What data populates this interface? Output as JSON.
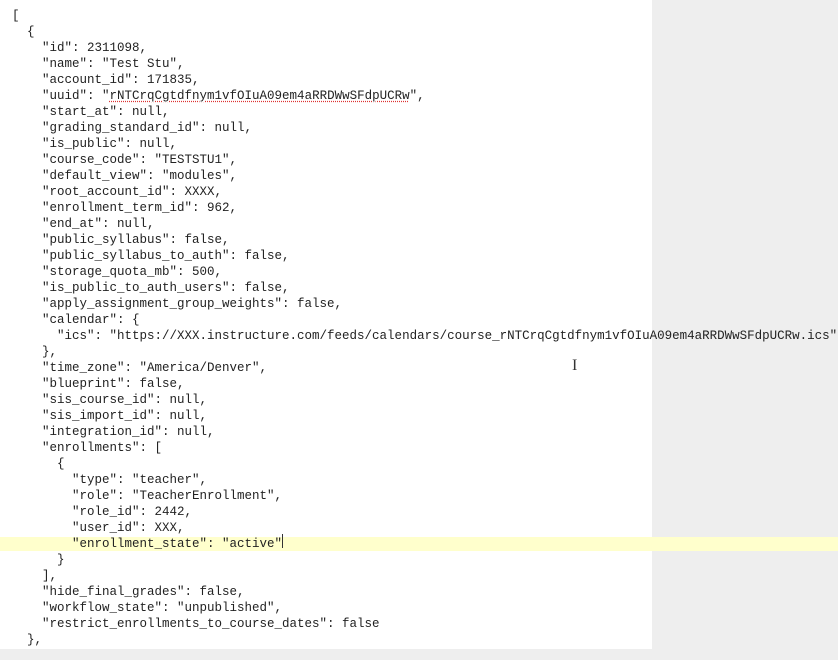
{
  "syntax": {
    "open_bracket": "[",
    "open_brace": "  {",
    "close_brace_comma": "  },",
    "cal_open": "    \"calendar\": {",
    "cal_close": "    },",
    "enroll_open": "    \"enrollments\": [",
    "enroll_obj_open": "      {",
    "enroll_obj_close": "      }",
    "enroll_close": "    ],"
  },
  "course": {
    "id": "    \"id\": 2311098,",
    "name": "    \"name\": \"Test Stu\",",
    "account_id": "    \"account_id\": 171835,",
    "uuid_prefix": "    \"uuid\": \"",
    "uuid_value": "rNTCrqCgtdfnym1vfOIuA09em4aRRDWwSFdpUCRw",
    "uuid_suffix": "\",",
    "start_at": "    \"start_at\": null,",
    "grading_standard_id": "    \"grading_standard_id\": null,",
    "is_public": "    \"is_public\": null,",
    "course_code": "    \"course_code\": \"TESTSTU1\",",
    "default_view": "    \"default_view\": \"modules\",",
    "root_account_id": "    \"root_account_id\": XXXX,",
    "enrollment_term_id": "    \"enrollment_term_id\": 962,",
    "end_at": "    \"end_at\": null,",
    "public_syllabus": "    \"public_syllabus\": false,",
    "public_syllabus_to_auth": "    \"public_syllabus_to_auth\": false,",
    "storage_quota_mb": "    \"storage_quota_mb\": 500,",
    "is_public_to_auth_users": "    \"is_public_to_auth_users\": false,",
    "apply_assignment_group_weights": "    \"apply_assignment_group_weights\": false,",
    "ics": "      \"ics\": \"https://XXX.instructure.com/feeds/calendars/course_rNTCrqCgtdfnym1vfOIuA09em4aRRDWwSFdpUCRw.ics\"",
    "time_zone": "    \"time_zone\": \"America/Denver\",",
    "blueprint": "    \"blueprint\": false,",
    "sis_course_id": "    \"sis_course_id\": null,",
    "sis_import_id": "    \"sis_import_id\": null,",
    "integration_id": "    \"integration_id\": null,",
    "hide_final_grades": "    \"hide_final_grades\": false,",
    "workflow_state": "    \"workflow_state\": \"unpublished\",",
    "restrict": "    \"restrict_enrollments_to_course_dates\": false"
  },
  "enrollment": {
    "type": "        \"type\": \"teacher\",",
    "role": "        \"role\": \"TeacherEnrollment\",",
    "role_id": "        \"role_id\": 2442,",
    "user_id": "        \"user_id\": XXX,",
    "state": "        \"enrollment_state\": \"active\""
  },
  "cursor": {
    "ibeam_glyph": "I"
  }
}
